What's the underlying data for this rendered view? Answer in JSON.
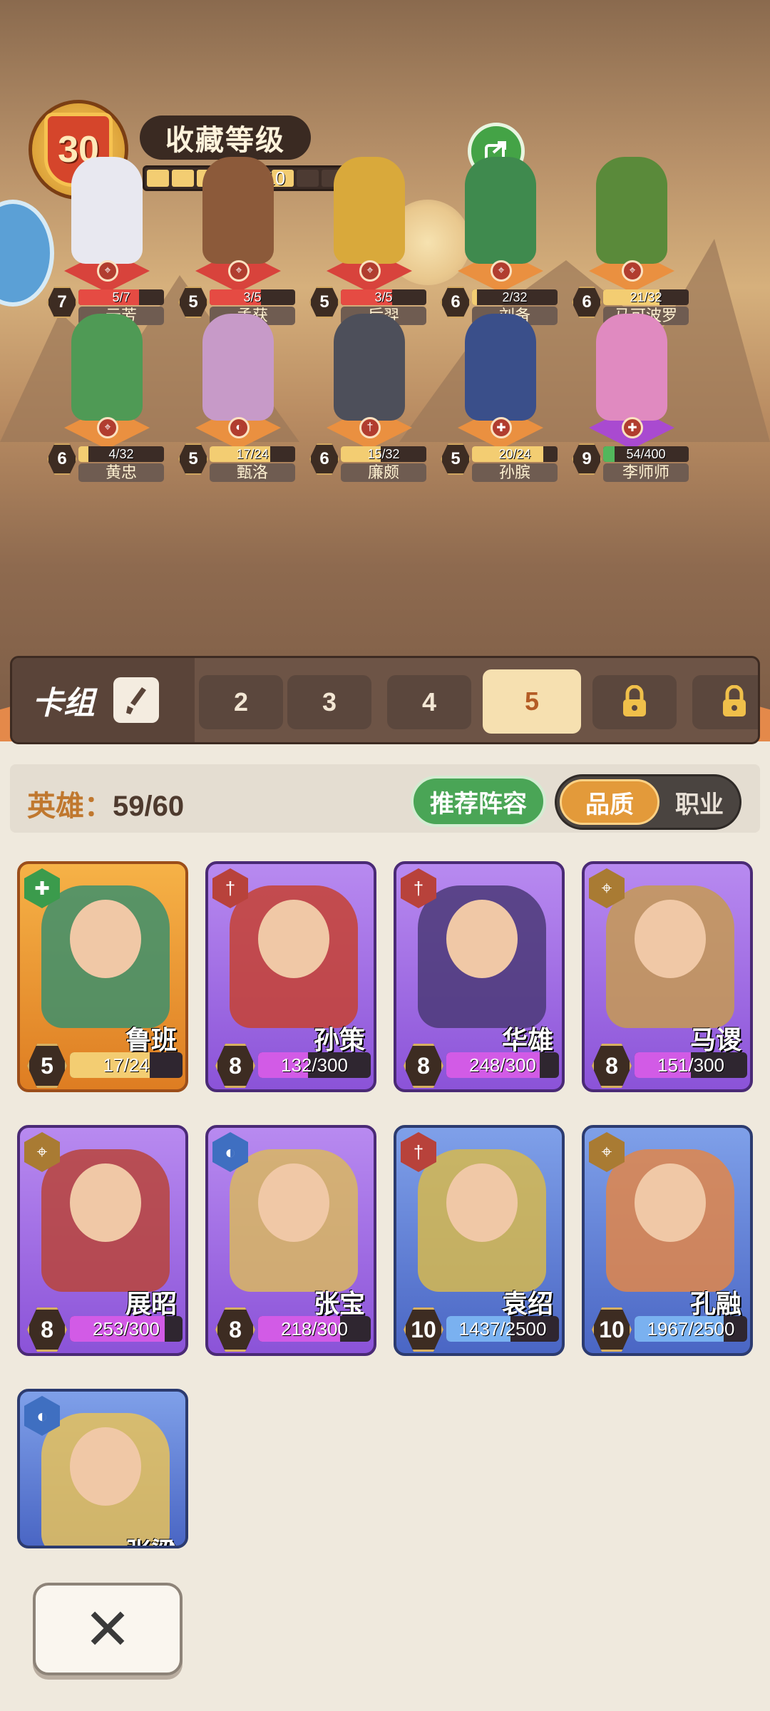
{
  "collection": {
    "level": "30",
    "title": "收藏等级",
    "progress_text": "6/10",
    "progress": 0.6
  },
  "lineup": [
    {
      "name": "元芳",
      "level": "7",
      "progress": "5/7",
      "fill": 0.71,
      "color": "red",
      "class_icon": "crossbow-icon"
    },
    {
      "name": "孟获",
      "level": "5",
      "progress": "3/5",
      "fill": 0.6,
      "color": "red",
      "class_icon": "crossbow-icon"
    },
    {
      "name": "后羿",
      "level": "5",
      "progress": "3/5",
      "fill": 0.6,
      "color": "red",
      "class_icon": "crossbow-icon"
    },
    {
      "name": "刘备",
      "level": "6",
      "progress": "2/32",
      "fill": 0.06,
      "color": "orange",
      "class_icon": "crossbow-icon"
    },
    {
      "name": "马可波罗",
      "level": "6",
      "progress": "21/32",
      "fill": 0.66,
      "color": "orange",
      "class_icon": "crossbow-icon"
    },
    {
      "name": "黄忠",
      "level": "6",
      "progress": "4/32",
      "fill": 0.12,
      "color": "orange",
      "class_icon": "crossbow-icon"
    },
    {
      "name": "甄洛",
      "level": "5",
      "progress": "17/24",
      "fill": 0.71,
      "color": "orange",
      "class_icon": "mage-icon"
    },
    {
      "name": "廉颇",
      "level": "6",
      "progress": "15/32",
      "fill": 0.47,
      "color": "orange",
      "class_icon": "sword-icon"
    },
    {
      "name": "孙膑",
      "level": "5",
      "progress": "20/24",
      "fill": 0.83,
      "color": "orange",
      "class_icon": "support-icon"
    },
    {
      "name": "李师师",
      "level": "9",
      "progress": "54/400",
      "fill": 0.135,
      "color": "purple",
      "class_icon": "support-icon"
    }
  ],
  "deck": {
    "label": "卡组",
    "tabs": [
      "2",
      "3",
      "4",
      "5"
    ],
    "selected": "5"
  },
  "heroes": {
    "label": "英雄：",
    "count": "59/60",
    "recommend": "推荐阵容",
    "toggle_quality": "品质",
    "toggle_class": "职业"
  },
  "cards": [
    {
      "name": "鲁班",
      "level": "5",
      "progress": "17/24",
      "fill": 0.71,
      "rarity": "orange",
      "icon": "support-icon",
      "icon_color": "green"
    },
    {
      "name": "孙策",
      "level": "8",
      "progress": "132/300",
      "fill": 0.44,
      "rarity": "purple",
      "icon": "sword-icon",
      "icon_color": "red"
    },
    {
      "name": "华雄",
      "level": "8",
      "progress": "248/300",
      "fill": 0.83,
      "rarity": "purple",
      "icon": "sword-icon",
      "icon_color": "red"
    },
    {
      "name": "马谡",
      "level": "8",
      "progress": "151/300",
      "fill": 0.5,
      "rarity": "purple",
      "icon": "crossbow-icon",
      "icon_color": "brown"
    },
    {
      "name": "展昭",
      "level": "8",
      "progress": "253/300",
      "fill": 0.84,
      "rarity": "purple",
      "icon": "crossbow-icon",
      "icon_color": "brown"
    },
    {
      "name": "张宝",
      "level": "8",
      "progress": "218/300",
      "fill": 0.73,
      "rarity": "purple",
      "icon": "mage-icon",
      "icon_color": "blue"
    },
    {
      "name": "袁绍",
      "level": "10",
      "progress": "1437/2500",
      "fill": 0.57,
      "rarity": "blue",
      "icon": "sword-icon",
      "icon_color": "red"
    },
    {
      "name": "孔融",
      "level": "10",
      "progress": "1967/2500",
      "fill": 0.79,
      "rarity": "blue",
      "icon": "crossbow-icon",
      "icon_color": "brown"
    },
    {
      "name": "张梁",
      "level": "",
      "progress": "",
      "fill": 0,
      "rarity": "blue",
      "icon": "mage-icon",
      "icon_color": "blue"
    }
  ],
  "close_label": "✕"
}
